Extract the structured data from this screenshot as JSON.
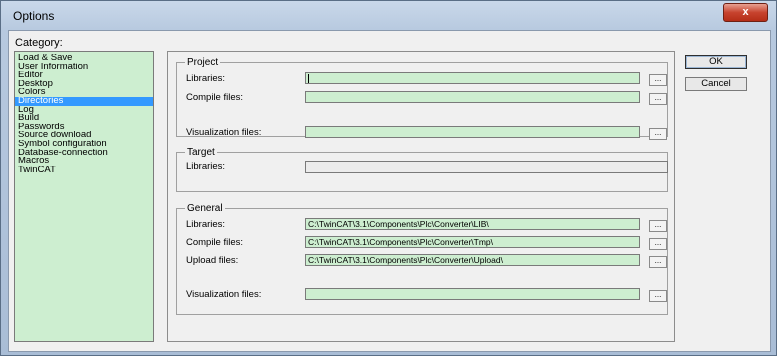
{
  "window": {
    "title": "Options",
    "close_label": "x"
  },
  "category": {
    "label": "Category:",
    "items": [
      "Load & Save",
      "User Information",
      "Editor",
      "Desktop",
      "Colors",
      "Directories",
      "Log",
      "Build",
      "Passwords",
      "Source download",
      "Symbol configuration",
      "Database-connection",
      "Macros",
      "TwinCAT"
    ],
    "selected": "Directories"
  },
  "project": {
    "title": "Project",
    "libraries_label": "Libraries:",
    "libraries_value": "",
    "compile_label": "Compile files:",
    "compile_value": "",
    "visualization_label": "Visualization files:",
    "visualization_value": ""
  },
  "target": {
    "title": "Target",
    "libraries_label": "Libraries:",
    "libraries_value": ""
  },
  "general": {
    "title": "General",
    "libraries_label": "Libraries:",
    "libraries_value": "C:\\TwinCAT\\3.1\\Components\\Plc\\Converter\\LIB\\",
    "compile_label": "Compile files:",
    "compile_value": "C:\\TwinCAT\\3.1\\Components\\Plc\\Converter\\Tmp\\",
    "upload_label": "Upload files:",
    "upload_value": "C:\\TwinCAT\\3.1\\Components\\Plc\\Converter\\Upload\\",
    "visualization_label": "Visualization files:",
    "visualization_value": ""
  },
  "browse_label": "...",
  "buttons": {
    "ok": "OK",
    "cancel": "Cancel"
  }
}
